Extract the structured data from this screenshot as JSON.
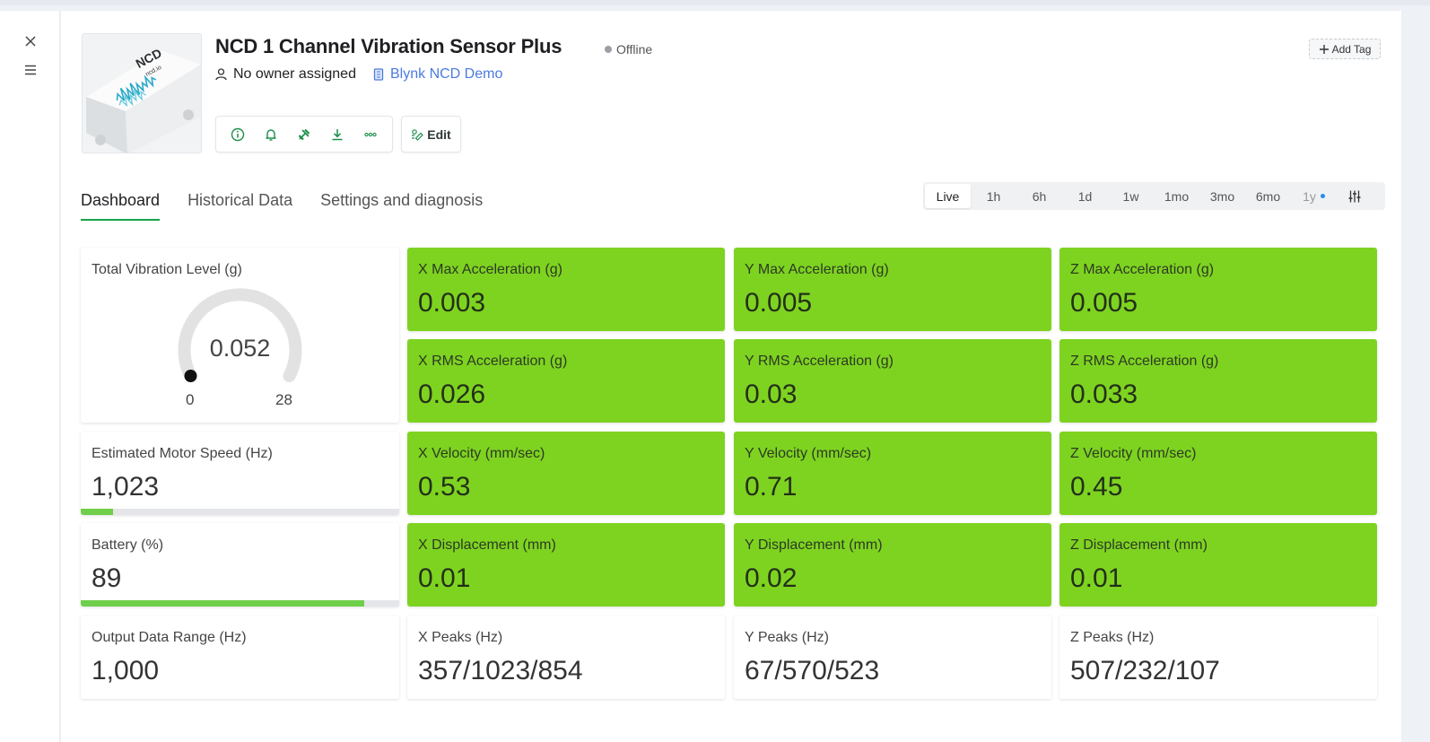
{
  "device": {
    "title": "NCD 1 Channel Vibration Sensor Plus",
    "status": "Offline",
    "owner": "No owner assigned",
    "organization": "Blynk NCD Demo",
    "edit_label": "Edit",
    "add_tag_label": "Add Tag",
    "image_text": [
      "NCD",
      "ncd.io"
    ]
  },
  "tabs": [
    "Dashboard",
    "Historical Data",
    "Settings and diagnosis"
  ],
  "time_ranges": [
    "Live",
    "1h",
    "6h",
    "1d",
    "1w",
    "1mo",
    "3mo",
    "6mo",
    "1y"
  ],
  "colors": {
    "tile_green": "#7ed321",
    "tab_underline": "#16a34a",
    "link": "#4a7be0",
    "bar_fill": "#6fcf4a"
  },
  "widgets": {
    "total_vibration": {
      "label": "Total Vibration Level (g)",
      "value": "0.052",
      "min": "0",
      "max": "28",
      "level": 0.002
    },
    "motor_speed": {
      "label": "Estimated Motor Speed (Hz)",
      "value": "1,023",
      "level": 0.1
    },
    "battery": {
      "label": "Battery (%)",
      "value": "89",
      "level": 0.89
    },
    "output_range": {
      "label": "Output Data Range (Hz)",
      "value": "1,000"
    },
    "x_max": {
      "label": "X Max Acceleration (g)",
      "value": "0.003"
    },
    "y_max": {
      "label": "Y Max Acceleration (g)",
      "value": "0.005"
    },
    "z_max": {
      "label": "Z Max Acceleration (g)",
      "value": "0.005"
    },
    "x_rms": {
      "label": "X RMS Acceleration (g)",
      "value": "0.026"
    },
    "y_rms": {
      "label": "Y RMS Acceleration (g)",
      "value": "0.03"
    },
    "z_rms": {
      "label": "Z RMS Acceleration (g)",
      "value": "0.033"
    },
    "x_vel": {
      "label": "X Velocity (mm/sec)",
      "value": "0.53"
    },
    "y_vel": {
      "label": "Y Velocity (mm/sec)",
      "value": "0.71"
    },
    "z_vel": {
      "label": "Z Velocity (mm/sec)",
      "value": "0.45"
    },
    "x_disp": {
      "label": "X Displacement (mm)",
      "value": "0.01"
    },
    "y_disp": {
      "label": "Y Displacement (mm)",
      "value": "0.02"
    },
    "z_disp": {
      "label": "Z Displacement (mm)",
      "value": "0.01"
    },
    "x_peaks": {
      "label": "X Peaks (Hz)",
      "value": "357/1023/854"
    },
    "y_peaks": {
      "label": "Y Peaks (Hz)",
      "value": "67/570/523"
    },
    "z_peaks": {
      "label": "Z Peaks (Hz)",
      "value": "507/232/107"
    }
  }
}
